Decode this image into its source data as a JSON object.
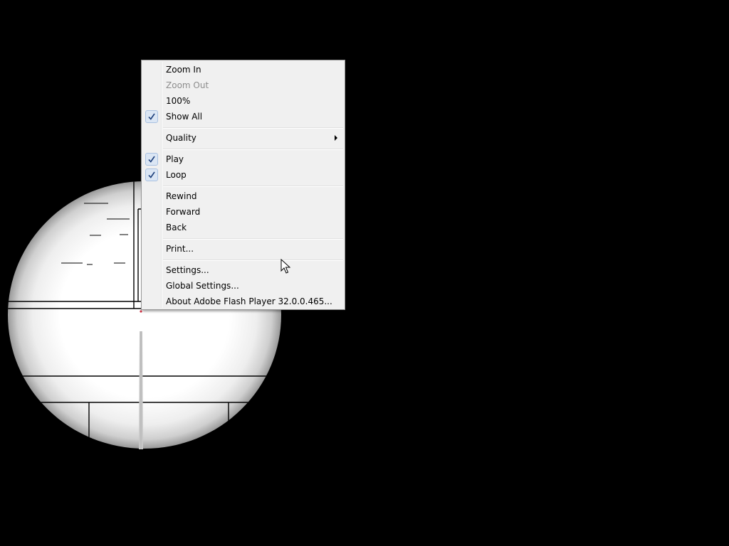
{
  "context_menu": {
    "items": [
      {
        "label": "Zoom In",
        "enabled": true,
        "checked": false
      },
      {
        "label": "Zoom Out",
        "enabled": false,
        "checked": false
      },
      {
        "label": "100%",
        "enabled": true,
        "checked": false
      },
      {
        "label": "Show All",
        "enabled": true,
        "checked": true
      },
      {
        "label": "Quality",
        "enabled": true,
        "checked": false,
        "submenu": true
      },
      {
        "label": "Play",
        "enabled": true,
        "checked": true
      },
      {
        "label": "Loop",
        "enabled": true,
        "checked": true
      },
      {
        "label": "Rewind",
        "enabled": true,
        "checked": false
      },
      {
        "label": "Forward",
        "enabled": true,
        "checked": false
      },
      {
        "label": "Back",
        "enabled": true,
        "checked": false
      },
      {
        "label": "Print...",
        "enabled": true,
        "checked": false
      },
      {
        "label": "Settings...",
        "enabled": true,
        "checked": false
      },
      {
        "label": "Global Settings...",
        "enabled": true,
        "checked": false
      },
      {
        "label": "About Adobe Flash Player 32.0.0.465...",
        "enabled": true,
        "checked": false
      }
    ]
  },
  "icons": {
    "check": "check-icon",
    "submenu": "submenu-arrow-icon",
    "cursor": "mouse-pointer-icon"
  },
  "colors": {
    "background": "#000000",
    "menu_background": "#f0f0f0",
    "menu_border": "#979797",
    "check_highlight": "#dbe6f4",
    "disabled_text": "#8d8d8d"
  }
}
